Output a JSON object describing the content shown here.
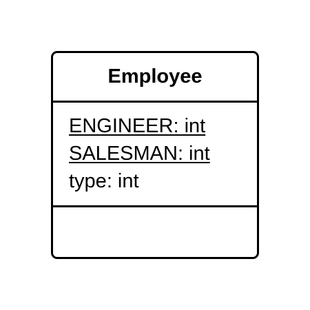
{
  "class": {
    "name": "Employee",
    "attributes": [
      {
        "text": "ENGINEER: int",
        "static": true
      },
      {
        "text": "SALESMAN: int",
        "static": true
      },
      {
        "text": "type: int",
        "static": false
      }
    ],
    "operations": []
  }
}
